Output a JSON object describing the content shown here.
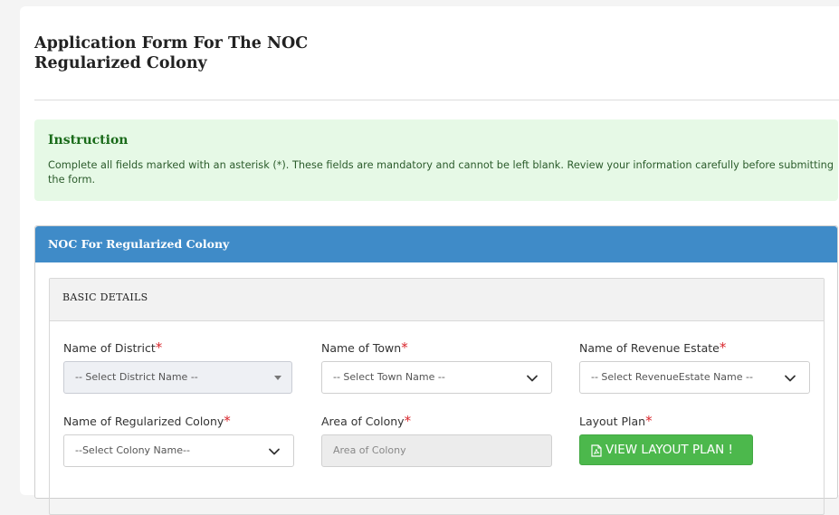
{
  "page": {
    "title": "Application Form For The NOC Regularized Colony"
  },
  "instruction": {
    "heading": "Instruction",
    "text": "Complete all fields marked with an asterisk (*). These fields are mandatory and cannot be left blank. Review your information carefully before submitting the form."
  },
  "panel": {
    "title": "NOC For Regularized Colony"
  },
  "basic_details": {
    "title": "BASIC DETAILS",
    "required_marker": "*",
    "district": {
      "label": "Name of District",
      "value": "-- Select District Name --"
    },
    "town": {
      "label": "Name of Town",
      "value": "-- Select Town Name --"
    },
    "revenue_estate": {
      "label": "Name of Revenue Estate",
      "value": "-- Select RevenueEstate Name --"
    },
    "colony": {
      "label": "Name of Regularized Colony",
      "value": "--Select Colony Name--"
    },
    "area": {
      "label": "Area of Colony",
      "placeholder": "Area of Colony"
    },
    "layout": {
      "label": "Layout Plan",
      "button_label": "VIEW LAYOUT PLAN !"
    }
  },
  "colors": {
    "accent": "#3f8bc8",
    "instruction_bg": "#e6f9e6",
    "button_green": "#4cb84c",
    "required_red": "#d9262c"
  },
  "icons": {
    "dropdown": "chevron-down-icon",
    "pdf": "file-pdf-icon"
  }
}
